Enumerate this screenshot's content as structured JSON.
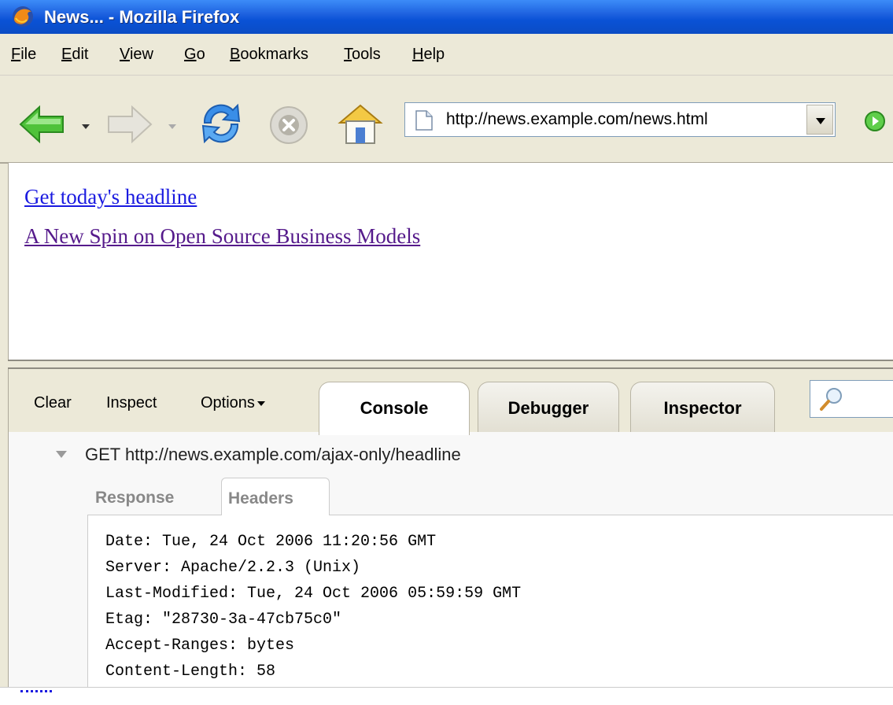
{
  "window": {
    "title": "News... - Mozilla Firefox"
  },
  "menu": {
    "items": [
      {
        "label": "File"
      },
      {
        "label": "Edit"
      },
      {
        "label": "View"
      },
      {
        "label": "Go"
      },
      {
        "label": "Bookmarks"
      },
      {
        "label": "Tools"
      },
      {
        "label": "Help"
      }
    ]
  },
  "navbar": {
    "url": "http://news.example.com/news.html",
    "icons": [
      "back-arrow-icon",
      "forward-arrow-icon",
      "reload-icon",
      "stop-icon",
      "home-icon",
      "go-icon"
    ]
  },
  "page": {
    "links": [
      {
        "text": "Get today's headline",
        "visited": false
      },
      {
        "text": "A New Spin on Open Source Business Models",
        "visited": true
      }
    ]
  },
  "firebug": {
    "commands": [
      "Clear",
      "Inspect",
      "Options"
    ],
    "tabs": [
      "Console",
      "Debugger",
      "Inspector"
    ],
    "active_tab": "Console",
    "request": "GET http://news.example.com/ajax-only/headline",
    "subtabs": [
      "Response",
      "Headers"
    ],
    "active_subtab": "Headers",
    "headers": [
      "Date: Tue, 24 Oct 2006 11:20:56 GMT",
      "Server: Apache/2.2.3 (Unix)",
      "Last-Modified: Tue, 24 Oct 2006 05:59:59 GMT",
      "Etag: \"28730-3a-47cb75c0\"",
      "Accept-Ranges: bytes",
      "Content-Length: 58"
    ]
  },
  "colors": {
    "titlebar": "#0a52d6",
    "link": "#1a1ae0",
    "visited": "#551a8b",
    "chrome": "#ece9d8"
  }
}
